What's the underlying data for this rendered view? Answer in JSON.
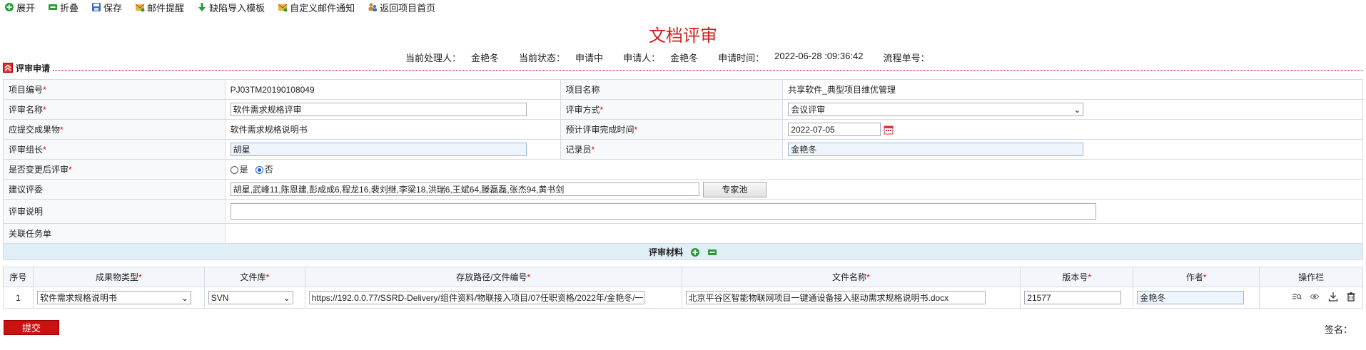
{
  "toolbar": {
    "expand": "展开",
    "collapse": "折叠",
    "save": "保存",
    "mail_remind": "邮件提醒",
    "defect_import": "缺陷导入模板",
    "custom_mail": "自定义邮件通知",
    "back_home": "返回项目首页"
  },
  "page_title": "文档评审",
  "info": {
    "handler_label": "当前处理人：",
    "handler": "金艳冬",
    "status_label": "当前状态：",
    "status": "申请中",
    "applicant_label": "申请人：",
    "applicant": "金艳冬",
    "apply_time_label": "申请时间：",
    "apply_time": "2022-06-28 :09:36:42",
    "flow_no_label": "流程单号："
  },
  "section_title": "评审申请",
  "form": {
    "project_no_label": "项目编号",
    "project_no": "PJ03TM20190108049",
    "project_name_label": "项目名称",
    "project_name": "共享软件_典型项目维优管理",
    "review_name_label": "评审名称",
    "review_name": "软件需求规格评审",
    "review_method_label": "评审方式",
    "review_method": "会议评审",
    "deliverable_label": "应提交成果物",
    "deliverable": "软件需求规格说明书",
    "due_label": "预计评审完成时间",
    "due": "2022-07-05",
    "leader_label": "评审组长",
    "leader": "胡星",
    "recorder_label": "记录员",
    "recorder": "金艳冬",
    "post_change_label": "是否变更后评审",
    "yes": "是",
    "no": "否",
    "reviewers_label": "建议评委",
    "reviewers": "胡星,武峰11,陈恩建,彭成成6,程龙16,裴刘继,李梁18,洪瑞6,王斌64,滕磊磊,张杰94,黄书剑",
    "expert_pool": "专家池",
    "desc_label": "评审说明",
    "desc": "",
    "task_label": "关联任务单"
  },
  "materials": {
    "title": "评审材料",
    "columns": [
      "序号",
      "成果物类型",
      "文件库",
      "存放路径/文件编号",
      "文件名称",
      "版本号",
      "作者",
      "操作栏"
    ],
    "rows": [
      {
        "no": "1",
        "type": "软件需求规格说明书",
        "repo": "SVN",
        "path": "https://192.0.0.77/SSRD-Delivery/组件资料/物联接入项目/07任职资格/2022年/金艳冬/一",
        "file_name": "北京平谷区智能物联网项目一键通设备接入驱动需求规格说明书.docx",
        "version": "21577",
        "author": "金艳冬"
      }
    ]
  },
  "submit": "提交",
  "sign_label": "签名："
}
